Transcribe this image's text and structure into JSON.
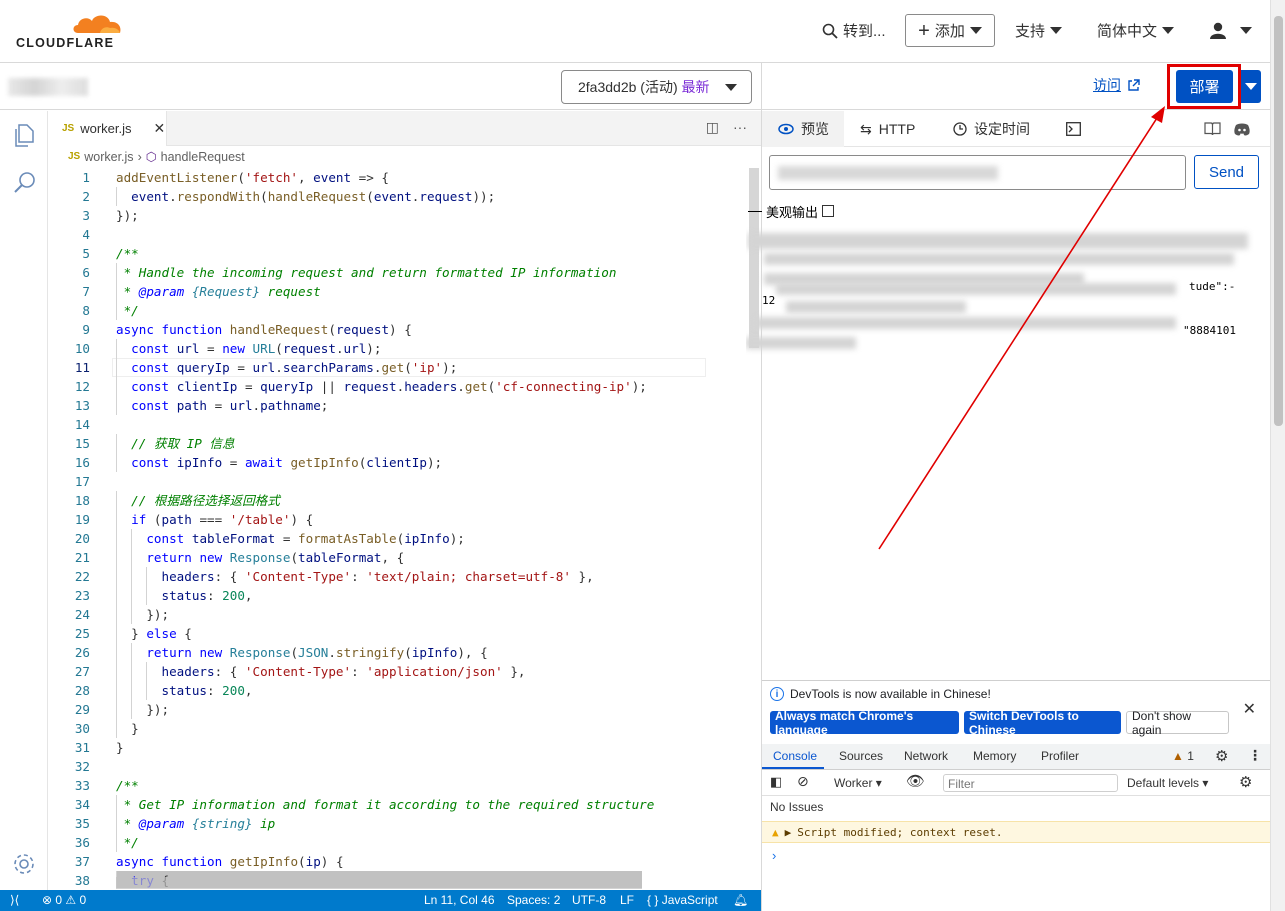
{
  "brand": {
    "logo_text": "CLOUDFLARE",
    "accent": "#f38020"
  },
  "topnav": {
    "goto_label": "转到...",
    "add_label": "添加",
    "support_label": "支持",
    "language_label": "简体中文"
  },
  "subbar": {
    "version_id": "2fa3dd2b",
    "version_status": "(活动)",
    "version_latest": "最新",
    "visit_label": "访问",
    "deploy_label": "部署"
  },
  "editor": {
    "tab_label": "worker.js",
    "breadcrumb": {
      "file": "worker.js",
      "symbol": "handleRequest"
    },
    "current_line": 11,
    "lines": [
      "addEventListener('fetch', event => {",
      "  event.respondWith(handleRequest(event.request));",
      "});",
      "",
      "/**",
      " * Handle the incoming request and return formatted IP information",
      " * @param {Request} request",
      " */",
      "async function handleRequest(request) {",
      "  const url = new URL(request.url);",
      "  const queryIp = url.searchParams.get('ip');",
      "  const clientIp = queryIp || request.headers.get('cf-connecting-ip');",
      "  const path = url.pathname;",
      "",
      "  // 获取 IP 信息",
      "  const ipInfo = await getIpInfo(clientIp);",
      "",
      "  // 根据路径选择返回格式",
      "  if (path === '/table') {",
      "    const tableFormat = formatAsTable(ipInfo);",
      "    return new Response(tableFormat, {",
      "      headers: { 'Content-Type': 'text/plain; charset=utf-8' },",
      "      status: 200,",
      "    });",
      "  } else {",
      "    return new Response(JSON.stringify(ipInfo), {",
      "      headers: { 'Content-Type': 'application/json' },",
      "      status: 200,",
      "    });",
      "  }",
      "}",
      "",
      "/**",
      " * Get IP information and format it according to the required structure",
      " * @param {string} ip",
      " */",
      "async function getIpInfo(ip) {",
      "  try {"
    ]
  },
  "statusbar": {
    "errors": "0",
    "warnings": "0",
    "position": "Ln 11, Col 46",
    "spaces": "Spaces: 2",
    "encoding": "UTF-8",
    "eol": "LF",
    "language": "JavaScript"
  },
  "preview": {
    "tabs": {
      "preview": "预览",
      "http": "HTTP",
      "schedule": "设定时间"
    },
    "send_label": "Send",
    "pretty_label": "美观输出",
    "response_fragments": {
      "f1": "tude\":-",
      "f2": "12",
      "f3": "\"8884101"
    }
  },
  "devtools": {
    "notice": "DevTools is now available in Chinese!",
    "btn_match": "Always match Chrome's language",
    "btn_switch": "Switch DevTools to Chinese",
    "btn_dont": "Don't show again",
    "tabs": [
      "Console",
      "Sources",
      "Network",
      "Memory",
      "Profiler"
    ],
    "warning_count": "1",
    "context": "Worker",
    "filter_placeholder": "Filter",
    "levels": "Default levels",
    "no_issues": "No Issues",
    "warning_msg": "Script modified; context reset."
  }
}
